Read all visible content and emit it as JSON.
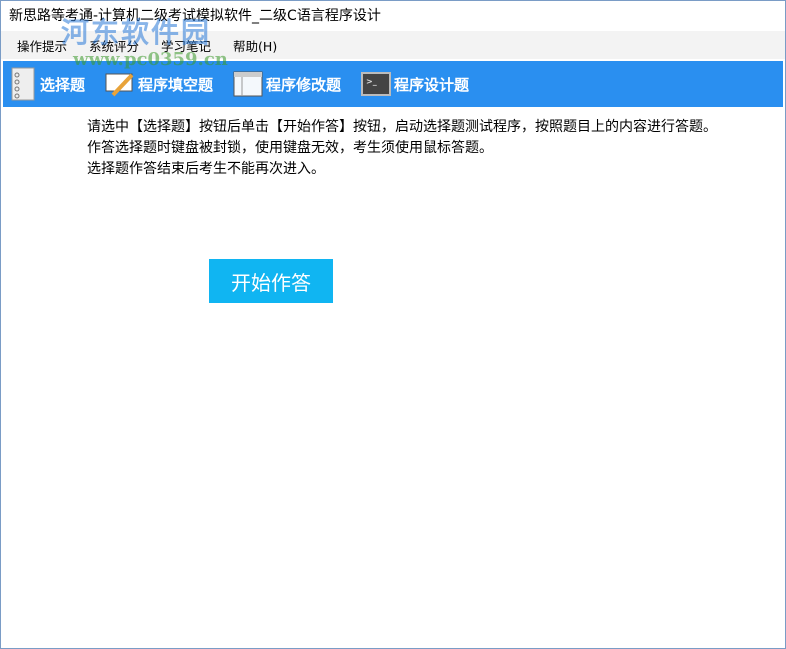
{
  "window": {
    "title": "新思路等考通-计算机二级考试模拟软件_二级C语言程序设计"
  },
  "menu": [
    "操作提示",
    "系统评分",
    "学习笔记",
    "帮助(H)"
  ],
  "toolbar": [
    {
      "label": "选择题",
      "icon": "checklist-icon"
    },
    {
      "label": "程序填空题",
      "icon": "pencil-edit-icon"
    },
    {
      "label": "程序修改题",
      "icon": "window-icon"
    },
    {
      "label": "程序设计题",
      "icon": "terminal-icon"
    }
  ],
  "content": {
    "lines": [
      "请选中【选择题】按钮后单击【开始作答】按钮，启动选择题测试程序，按照题目上的内容进行答题。",
      "作答选择题时键盘被封锁，使用键盘无效，考生须使用鼠标答题。",
      "选择题作答结束后考生不能再次进入。"
    ],
    "start_button": "开始作答"
  },
  "watermark": {
    "name": "河东软件园",
    "url": "www.pc0359.cn"
  }
}
